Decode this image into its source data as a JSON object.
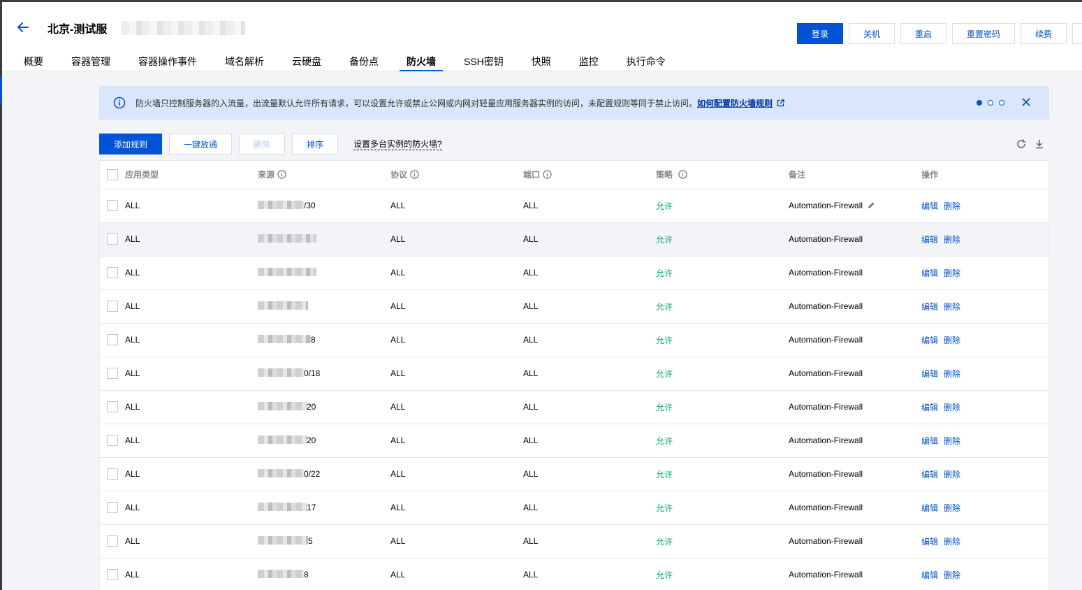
{
  "header": {
    "title": "北京-测试服",
    "actions": [
      "登录",
      "关机",
      "重启",
      "重置密码",
      "续费"
    ]
  },
  "tabs": [
    {
      "label": "概要",
      "active": false
    },
    {
      "label": "容器管理",
      "active": false
    },
    {
      "label": "容器操作事件",
      "active": false
    },
    {
      "label": "域名解析",
      "active": false
    },
    {
      "label": "云硬盘",
      "active": false
    },
    {
      "label": "备份点",
      "active": false
    },
    {
      "label": "防火墙",
      "active": true
    },
    {
      "label": "SSH密钥",
      "active": false
    },
    {
      "label": "快照",
      "active": false
    },
    {
      "label": "监控",
      "active": false
    },
    {
      "label": "执行命令",
      "active": false
    }
  ],
  "notice": {
    "text": "防火墙只控制服务器的入流量，出流量默认允许所有请求，可以设置允许或禁止公网或内网对轻量应用服务器实例的访问，未配置规则等同于禁止访问。",
    "link": "如何配置防火墙规则",
    "pages": 3,
    "current_page": 1
  },
  "toolbar": {
    "add": "添加规则",
    "allow_all": "一键放通",
    "delete": "删除",
    "sort": "排序",
    "multi_instance": "设置多台实例的防火墙?"
  },
  "table": {
    "columns": [
      "应用类型",
      "来源",
      "协议",
      "端口",
      "策略",
      "备注",
      "操作"
    ],
    "op_edit": "编辑",
    "op_delete": "删除",
    "rows": [
      {
        "type": "ALL",
        "source_tail": "/30",
        "protocol": "ALL",
        "port": "ALL",
        "policy": "允许",
        "remark": "Automation-Firewall"
      },
      {
        "type": "ALL",
        "source_tail": "",
        "protocol": "ALL",
        "port": "ALL",
        "policy": "允许",
        "remark": "Automation-Firewall"
      },
      {
        "type": "ALL",
        "source_tail": "",
        "protocol": "ALL",
        "port": "ALL",
        "policy": "允许",
        "remark": "Automation-Firewall"
      },
      {
        "type": "ALL",
        "source_tail": "",
        "protocol": "ALL",
        "port": "ALL",
        "policy": "允许",
        "remark": "Automation-Firewall"
      },
      {
        "type": "ALL",
        "source_tail": "8",
        "protocol": "ALL",
        "port": "ALL",
        "policy": "允许",
        "remark": "Automation-Firewall"
      },
      {
        "type": "ALL",
        "source_tail": "0/18",
        "protocol": "ALL",
        "port": "ALL",
        "policy": "允许",
        "remark": "Automation-Firewall"
      },
      {
        "type": "ALL",
        "source_tail": "20",
        "protocol": "ALL",
        "port": "ALL",
        "policy": "允许",
        "remark": "Automation-Firewall"
      },
      {
        "type": "ALL",
        "source_tail": "20",
        "protocol": "ALL",
        "port": "ALL",
        "policy": "允许",
        "remark": "Automation-Firewall"
      },
      {
        "type": "ALL",
        "source_tail": "0/22",
        "protocol": "ALL",
        "port": "ALL",
        "policy": "允许",
        "remark": "Automation-Firewall"
      },
      {
        "type": "ALL",
        "source_tail": "17",
        "protocol": "ALL",
        "port": "ALL",
        "policy": "允许",
        "remark": "Automation-Firewall"
      },
      {
        "type": "ALL",
        "source_tail": "5",
        "protocol": "ALL",
        "port": "ALL",
        "policy": "允许",
        "remark": "Automation-Firewall"
      },
      {
        "type": "ALL",
        "source_tail": "8",
        "protocol": "ALL",
        "port": "ALL",
        "policy": "允许",
        "remark": "Automation-Firewall"
      }
    ]
  },
  "colors": {
    "primary": "#0052d9",
    "allow": "#00a870",
    "notice_bg": "#d9e6fb"
  }
}
